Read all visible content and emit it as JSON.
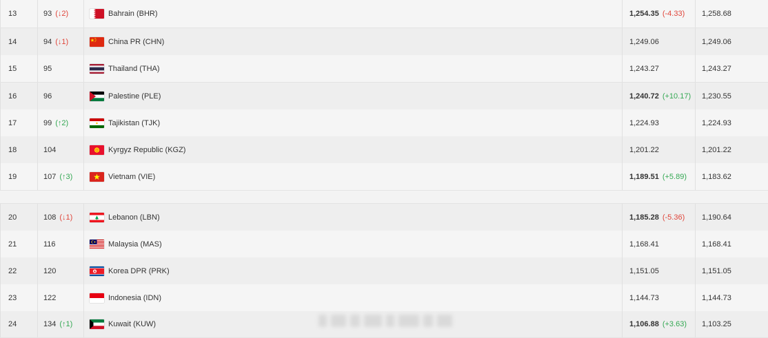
{
  "rows": [
    {
      "pos": "13",
      "rank": "93",
      "rank_change": "(↓2)",
      "rank_dir": "down",
      "team": "Bahrain (BHR)",
      "flag": "bahrain-flag-icon",
      "points": "1,254.35",
      "points_bold": true,
      "points_change": "(-4.33)",
      "points_dir": "down",
      "prev": "1,258.68"
    },
    {
      "pos": "14",
      "rank": "94",
      "rank_change": "(↓1)",
      "rank_dir": "down",
      "team": "China PR (CHN)",
      "flag": "china-flag-icon",
      "points": "1,249.06",
      "points_bold": false,
      "points_change": "",
      "points_dir": "",
      "prev": "1,249.06"
    },
    {
      "pos": "15",
      "rank": "95",
      "rank_change": "",
      "rank_dir": "",
      "team": "Thailand (THA)",
      "flag": "thailand-flag-icon",
      "points": "1,243.27",
      "points_bold": false,
      "points_change": "",
      "points_dir": "",
      "prev": "1,243.27"
    },
    {
      "pos": "16",
      "rank": "96",
      "rank_change": "",
      "rank_dir": "",
      "team": "Palestine (PLE)",
      "flag": "palestine-flag-icon",
      "points": "1,240.72",
      "points_bold": true,
      "points_change": "(+10.17)",
      "points_dir": "up",
      "prev": "1,230.55"
    },
    {
      "pos": "17",
      "rank": "99",
      "rank_change": "(↑2)",
      "rank_dir": "up",
      "team": "Tajikistan (TJK)",
      "flag": "tajikistan-flag-icon",
      "points": "1,224.93",
      "points_bold": false,
      "points_change": "",
      "points_dir": "",
      "prev": "1,224.93"
    },
    {
      "pos": "18",
      "rank": "104",
      "rank_change": "",
      "rank_dir": "",
      "team": "Kyrgyz Republic (KGZ)",
      "flag": "kyrgyzstan-flag-icon",
      "points": "1,201.22",
      "points_bold": false,
      "points_change": "",
      "points_dir": "",
      "prev": "1,201.22"
    },
    {
      "pos": "19",
      "rank": "107",
      "rank_change": "(↑3)",
      "rank_dir": "up",
      "team": "Vietnam (VIE)",
      "flag": "vietnam-flag-icon",
      "points": "1,189.51",
      "points_bold": true,
      "points_change": "(+5.89)",
      "points_dir": "up",
      "prev": "1,183.62"
    },
    {
      "pos": "20",
      "rank": "108",
      "rank_change": "(↓1)",
      "rank_dir": "down",
      "team": "Lebanon (LBN)",
      "flag": "lebanon-flag-icon",
      "points": "1,185.28",
      "points_bold": true,
      "points_change": "(-5.36)",
      "points_dir": "down",
      "prev": "1,190.64"
    },
    {
      "pos": "21",
      "rank": "116",
      "rank_change": "",
      "rank_dir": "",
      "team": "Malaysia (MAS)",
      "flag": "malaysia-flag-icon",
      "points": "1,168.41",
      "points_bold": false,
      "points_change": "",
      "points_dir": "",
      "prev": "1,168.41"
    },
    {
      "pos": "22",
      "rank": "120",
      "rank_change": "",
      "rank_dir": "",
      "team": "Korea DPR (PRK)",
      "flag": "north-korea-flag-icon",
      "points": "1,151.05",
      "points_bold": false,
      "points_change": "",
      "points_dir": "",
      "prev": "1,151.05"
    },
    {
      "pos": "23",
      "rank": "122",
      "rank_change": "",
      "rank_dir": "",
      "team": "Indonesia (IDN)",
      "flag": "indonesia-flag-icon",
      "points": "1,144.73",
      "points_bold": false,
      "points_change": "",
      "points_dir": "",
      "prev": "1,144.73"
    },
    {
      "pos": "24",
      "rank": "134",
      "rank_change": "(↑1)",
      "rank_dir": "up",
      "team": "Kuwait (KUW)",
      "flag": "kuwait-flag-icon",
      "points": "1,106.88",
      "points_bold": true,
      "points_change": "(+3.63)",
      "points_dir": "up",
      "prev": "1,103.25"
    }
  ],
  "colors": {
    "up": "#34a853",
    "down": "#e0453a",
    "row_odd": "#f5f5f5",
    "row_even": "#eeeeee"
  }
}
